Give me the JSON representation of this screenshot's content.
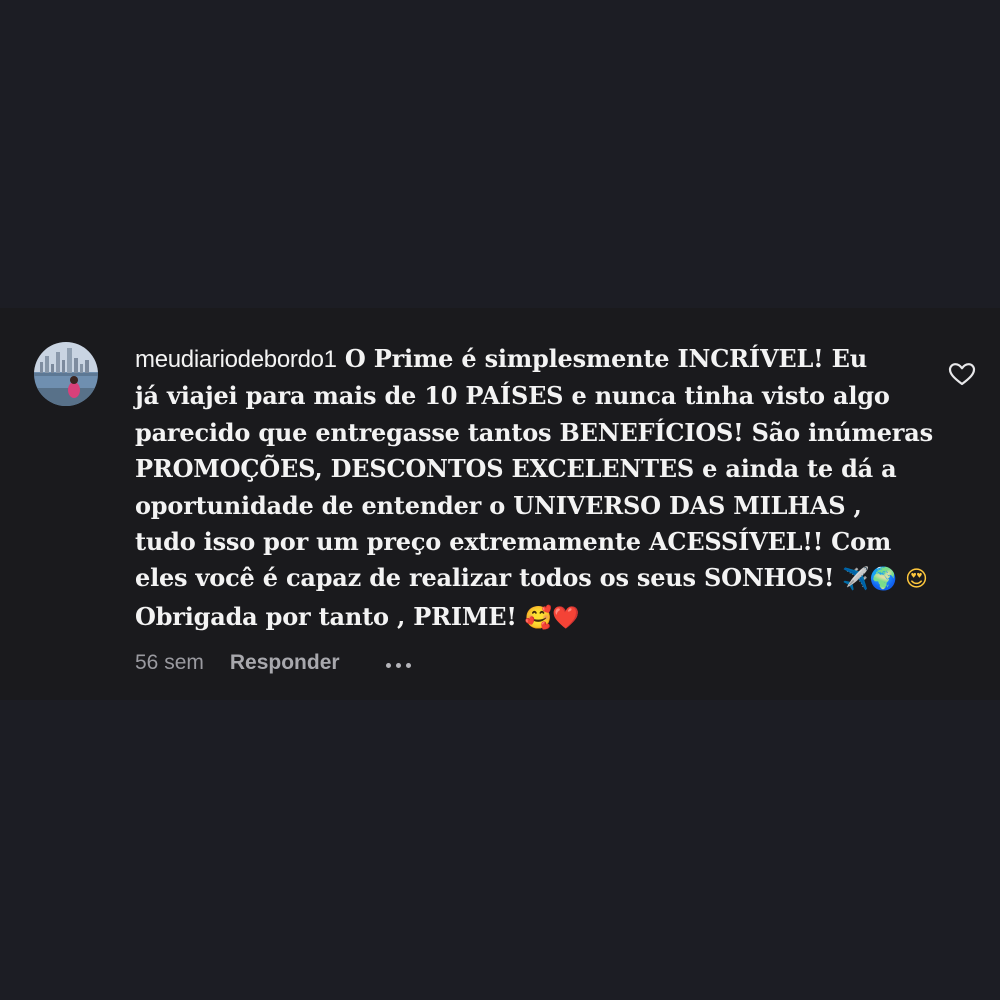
{
  "comment": {
    "username": "meudiariodebordo1",
    "lines": [
      "O Prime é simplesmente INCRÍVEL! Eu",
      "já viajei para mais de 10 PAÍSES e nunca tinha visto algo",
      "parecido que entregasse tantos BENEFÍCIOS! São inúmeras",
      "PROMOÇÕES, DESCONTOS EXCELENTES e ainda te dá a",
      "oportunidade de entender o UNIVERSO DAS MILHAS ,",
      "tudo isso por um preço extremamente ACESSÍVEL!! Com",
      "eles você é capaz de realizar todos os seus SONHOS!",
      "Obrigada por tanto , PRIME!"
    ],
    "emojis": {
      "plane": "✈️",
      "globe": "🌍",
      "love_face": "😍",
      "smile_hearts": "🥰",
      "heart": "❤️"
    },
    "timestamp": "56 sem",
    "reply_label": "Responder"
  },
  "icons": {
    "like": "heart-outline-icon",
    "more": "more-options-icon"
  },
  "colors": {
    "background": "#1c1d24",
    "card": "#1a1a1d",
    "text": "#f3f3f3",
    "muted": "#9a9aa0"
  }
}
